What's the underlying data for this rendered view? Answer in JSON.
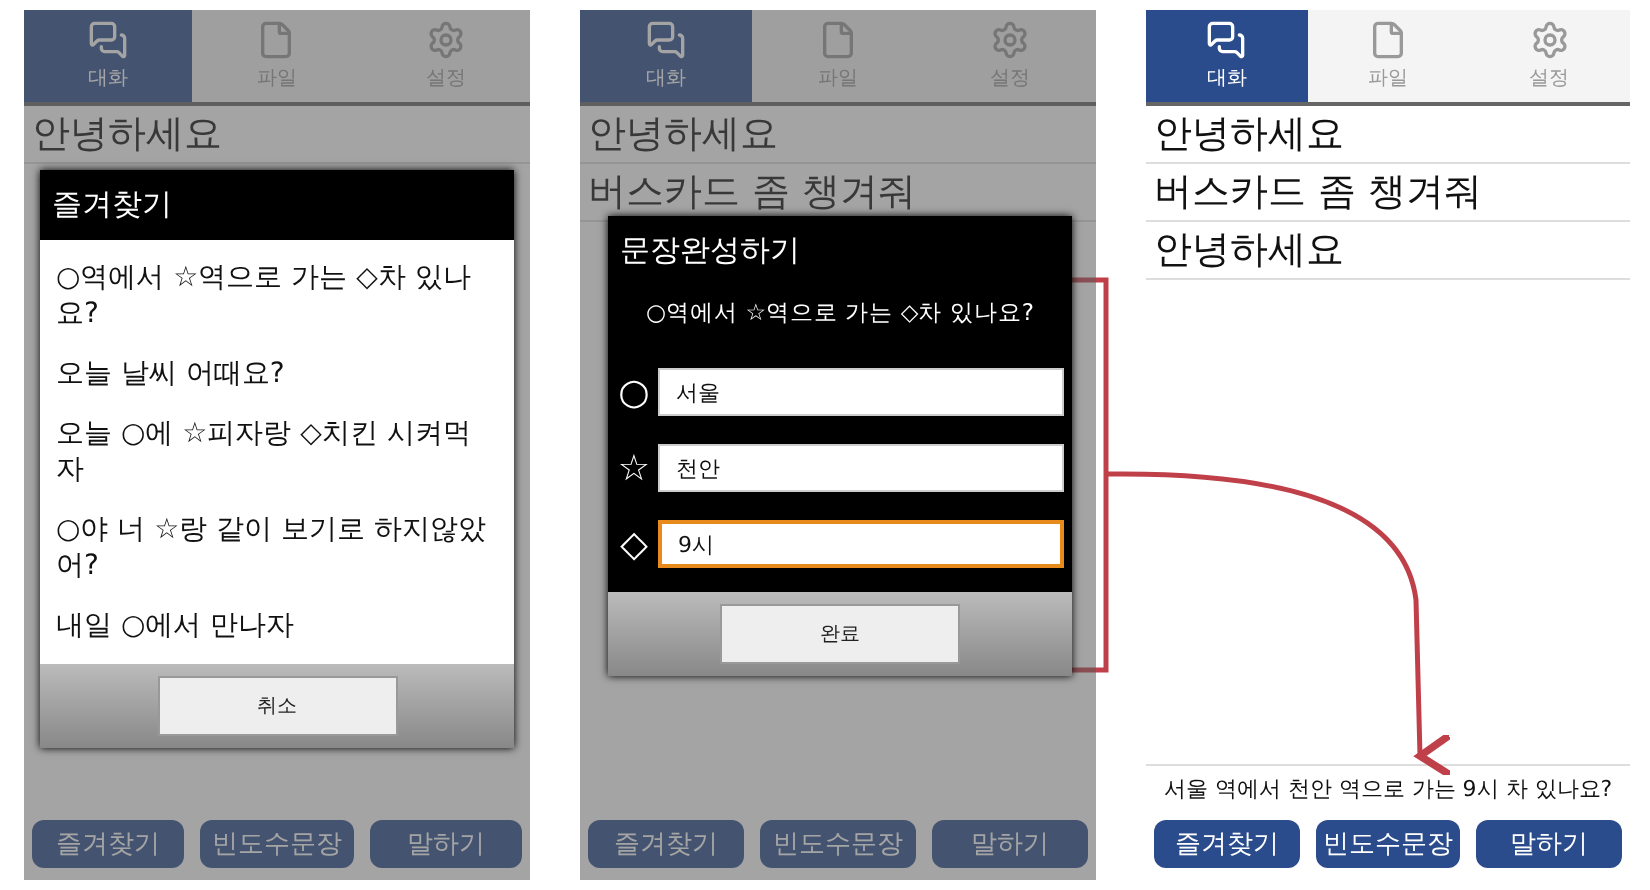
{
  "screens": [
    {
      "tabs": [
        {
          "label": "대화",
          "selected": true
        },
        {
          "label": "파일",
          "selected": false
        },
        {
          "label": "설정",
          "selected": false
        }
      ],
      "messages": [
        "안녕하세요"
      ],
      "dimmed": true,
      "dialog": {
        "kind": "favorites",
        "title": "즐겨찾기",
        "items": [
          "○역에서 ☆역으로 가는 ◇차 있나요?",
          "오늘 날씨 어때요?",
          "오늘 ○에 ☆피자랑 ◇치킨 시켜먹자",
          "○야 너 ☆랑 같이 보기로 하지않았어?",
          "내일 ○에서 만나자"
        ],
        "button": "취소"
      },
      "buttons": [
        "즐겨찾기",
        "빈도수문장",
        "말하기"
      ]
    },
    {
      "tabs": [
        {
          "label": "대화",
          "selected": true
        },
        {
          "label": "파일",
          "selected": false
        },
        {
          "label": "설정",
          "selected": false
        }
      ],
      "messages": [
        "안녕하세요",
        "버스카드 좀 챙겨줘"
      ],
      "dimmed": true,
      "dialog": {
        "kind": "complete",
        "title": "문장완성하기",
        "question": "○역에서 ☆역으로 가는 ◇차 있나요?",
        "fields": [
          {
            "symbol": "○",
            "value": "서울",
            "focused": false
          },
          {
            "symbol": "☆",
            "value": "천안",
            "focused": false
          },
          {
            "symbol": "◇",
            "value": "9시",
            "focused": true
          }
        ],
        "button": "완료"
      },
      "buttons": [
        "즐겨찾기",
        "빈도수문장",
        "말하기"
      ]
    },
    {
      "tabs": [
        {
          "label": "대화",
          "selected": true
        },
        {
          "label": "파일",
          "selected": false
        },
        {
          "label": "설정",
          "selected": false
        }
      ],
      "messages": [
        "안녕하세요",
        "버스카드 좀 챙겨줘",
        "안녕하세요"
      ],
      "dimmed": false,
      "result": "서울 역에서 천안 역으로 가는 9시 차 있나요?",
      "buttons": [
        "즐겨찾기",
        "빈도수문장",
        "말하기"
      ]
    }
  ]
}
